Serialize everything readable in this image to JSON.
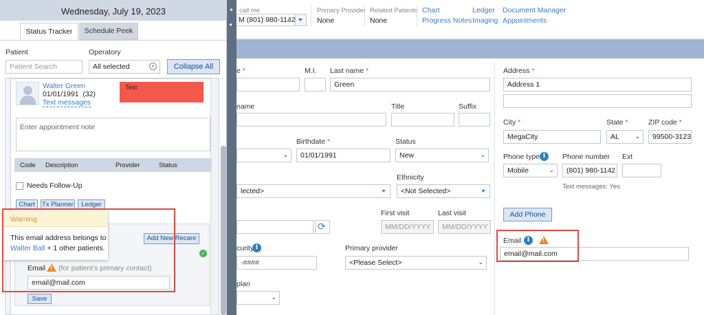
{
  "header": {
    "call_label": "call me",
    "phone": "M (801) 980-1142",
    "primary_provider_label": "Primary Provider",
    "primary_provider_value": "None",
    "related_patients_label": "Related Patients",
    "related_patients_value": "None",
    "links": [
      "Chart",
      "Ledger",
      "Document Manager",
      "Progress Notes",
      "Imaging",
      "Appointments"
    ]
  },
  "form": {
    "first_name_label": "e",
    "mi_label": "M.I.",
    "last_name_label": "Last name",
    "last_name_value": "Green",
    "nickname_label": "name",
    "title_label": "Title",
    "suffix_label": "Suffix",
    "birthdate_label": "Birthdate",
    "birthdate_value": "01/01/1991",
    "status_label": "Status",
    "status_value": "New",
    "ethnicity_label": "Ethnicity",
    "ethnicity_value": "<Not Selected>",
    "race_value": "lected>",
    "first_visit_label": "First visit",
    "last_visit_label": "Last visit",
    "date_placeholder": "MM/DD/YYYY",
    "ssn_label": "curity #",
    "ssn_value": "-####",
    "primary_provider_label": "Primary provider",
    "primary_provider_value": "<Please Select>",
    "plan_label": "plan",
    "address_label": "Address",
    "address1_value": "Address 1",
    "city_label": "City",
    "city_value": "MegaCity",
    "state_label": "State",
    "state_value": "AL",
    "zip_label": "ZIP code",
    "zip_value": "99500-3123",
    "phone_type_label": "Phone type",
    "phone_type_value": "Mobile",
    "phone_number_label": "Phone number",
    "phone_number_value": "(801) 980-1142",
    "ext_label": "Ext",
    "text_messages_note": "Text messages: Yes",
    "add_phone_label": "Add Phone",
    "email_label": "Email",
    "email_value": "email@mail.com"
  },
  "panel": {
    "date": "Wednesday, July 19, 2023",
    "tab_status": "Status Tracker",
    "tab_schedule": "Schedule Peek",
    "patient_label": "Patient",
    "operatory_label": "Operatory",
    "patient_placeholder": "Patient Search",
    "operatory_value": "All selected",
    "collapse_label": "Collapse All",
    "patient_name": "Walter Green",
    "patient_dob": "01/01/1991  (32)",
    "text_messages_link": "Text messages",
    "appt_tag": "Test",
    "note_placeholder": "Enter appointment note",
    "col_code": "Code",
    "col_description": "Description",
    "col_provider": "Provider",
    "col_status": "Status",
    "needs_followup": "Needs Follow-Up",
    "btn_chart": "Chart",
    "btn_tx": "Tx Planner",
    "btn_ledger": "Ledger",
    "add_recare": "Add New Recare",
    "email_label": "Email",
    "email_hint": "(for patient's primary contact)",
    "email_value": "email@mail.com",
    "save_label": "Save"
  },
  "warning": {
    "title": "Warning",
    "text_pre": "This email address belongs to",
    "link": "Walter Ball",
    "text_post": " + 1 other patients."
  },
  "colors": {
    "accent": "#3a7bc8",
    "warning_header": "#fdf3d5",
    "warning_text": "#c9963a",
    "highlight_box": "#e2483f",
    "appt_tag": "#f2594b",
    "band": "#9fb4d2"
  }
}
